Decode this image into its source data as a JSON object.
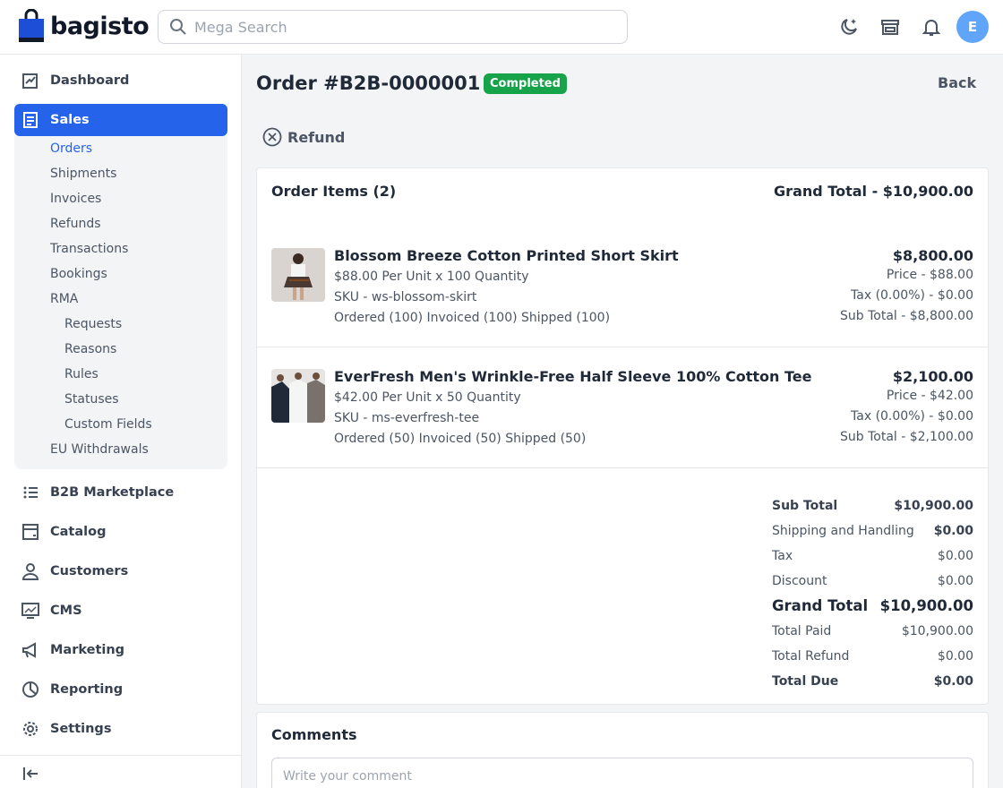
{
  "app": {
    "logo_text": "bagisto"
  },
  "header": {
    "search_placeholder": "Mega Search",
    "avatar_initial": "E",
    "icons": [
      "dark-mode-icon",
      "storefront-icon",
      "notification-bell-icon"
    ]
  },
  "sidebar": {
    "items": [
      {
        "label": "Dashboard",
        "icon": "dashboard-icon"
      },
      {
        "label": "Sales",
        "icon": "sales-icon"
      },
      {
        "label": "B2B Marketplace",
        "icon": "list-icon"
      },
      {
        "label": "Catalog",
        "icon": "catalog-icon"
      },
      {
        "label": "Customers",
        "icon": "customers-icon"
      },
      {
        "label": "CMS",
        "icon": "cms-icon"
      },
      {
        "label": "Marketing",
        "icon": "megaphone-icon"
      },
      {
        "label": "Reporting",
        "icon": "pie-chart-icon"
      },
      {
        "label": "Settings",
        "icon": "gear-icon"
      }
    ],
    "sales_sub": [
      "Orders",
      "Shipments",
      "Invoices",
      "Refunds",
      "Transactions",
      "Bookings",
      "RMA"
    ],
    "rma_sub": [
      "Requests",
      "Reasons",
      "Rules",
      "Statuses",
      "Custom Fields"
    ],
    "eu_withdrawals": "EU Withdrawals"
  },
  "order": {
    "title": "Order #B2B-0000001",
    "status": "Completed",
    "back_label": "Back",
    "refund_label": "Refund",
    "items_heading": "Order Items (2)",
    "grand_total_heading": "Grand Total - $10,900.00",
    "items": [
      {
        "name": "Blossom Breeze Cotton Printed Short Skirt",
        "unit_qty": "$88.00 Per Unit x 100 Quantity",
        "sku": "SKU - ws-blossom-skirt",
        "status_line": "Ordered (100) Invoiced (100) Shipped (100)",
        "total": "$8,800.00",
        "price": "Price - $88.00",
        "tax": "Tax (0.00%) - $0.00",
        "subtotal": "Sub Total - $8,800.00"
      },
      {
        "name": "EverFresh Men's Wrinkle-Free Half Sleeve 100% Cotton Tee",
        "unit_qty": "$42.00 Per Unit x 50 Quantity",
        "sku": "SKU - ms-everfresh-tee",
        "status_line": "Ordered (50) Invoiced (50) Shipped (50)",
        "total": "$2,100.00",
        "price": "Price - $42.00",
        "tax": "Tax (0.00%) - $0.00",
        "subtotal": "Sub Total - $2,100.00"
      }
    ],
    "summary": [
      {
        "label": "Sub Total",
        "value": "$10,900.00"
      },
      {
        "label": "Shipping and Handling",
        "value": "$0.00"
      },
      {
        "label": "Tax",
        "value": "$0.00"
      },
      {
        "label": "Discount",
        "value": "$0.00"
      },
      {
        "label": "Grand Total",
        "value": "$10,900.00"
      },
      {
        "label": "Total Paid",
        "value": "$10,900.00"
      },
      {
        "label": "Total Refund",
        "value": "$0.00"
      },
      {
        "label": "Total Due",
        "value": "$0.00"
      }
    ]
  },
  "comments": {
    "title": "Comments",
    "placeholder": "Write your comment"
  },
  "colors": {
    "primary": "#2563eb",
    "status_completed": "#16a34a",
    "avatar": "#60a5fa"
  }
}
